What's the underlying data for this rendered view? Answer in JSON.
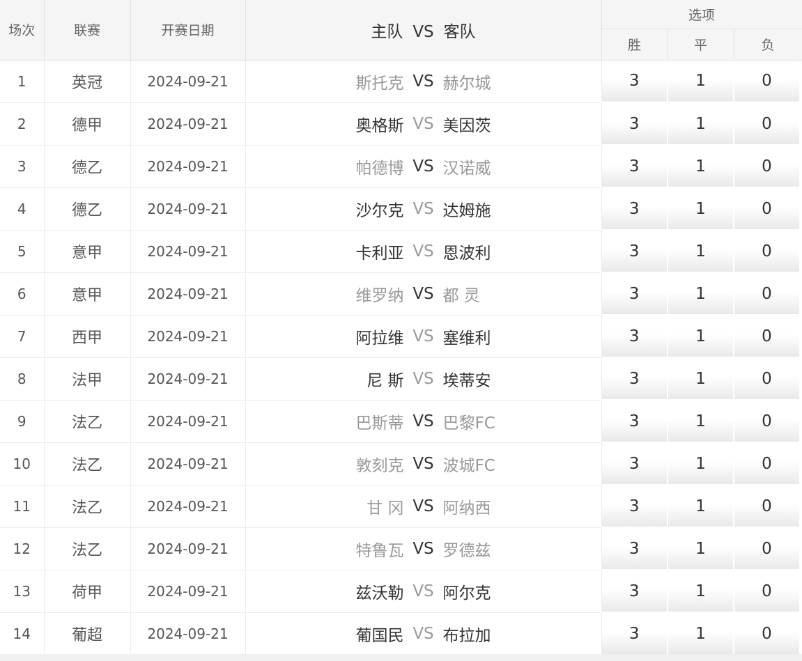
{
  "header": {
    "col_index": "场次",
    "col_league": "联赛",
    "col_date": "开赛日期",
    "col_home": "主队",
    "col_vs": "VS",
    "col_away": "客队",
    "col_options": "选项",
    "opt_win": "胜",
    "opt_draw": "平",
    "opt_lose": "负"
  },
  "colors": {
    "dark_team": "#333333",
    "light_team": "#999999",
    "header_bg": "#f5f5f5"
  },
  "rows": [
    {
      "num": "1",
      "league": "英冠",
      "date": "2024-09-21",
      "home": "斯托克",
      "vs": "VS",
      "away": "赫尔城",
      "home_style": "light",
      "vs_style": "dark",
      "away_style": "light",
      "win": "3",
      "draw": "1",
      "lose": "0"
    },
    {
      "num": "2",
      "league": "德甲",
      "date": "2024-09-21",
      "home": "奥格斯",
      "vs": "VS",
      "away": "美因茨",
      "home_style": "dark",
      "vs_style": "light",
      "away_style": "dark",
      "win": "3",
      "draw": "1",
      "lose": "0"
    },
    {
      "num": "3",
      "league": "德乙",
      "date": "2024-09-21",
      "home": "帕德博",
      "vs": "VS",
      "away": "汉诺威",
      "home_style": "light",
      "vs_style": "dark",
      "away_style": "light",
      "win": "3",
      "draw": "1",
      "lose": "0"
    },
    {
      "num": "4",
      "league": "德乙",
      "date": "2024-09-21",
      "home": "沙尔克",
      "vs": "VS",
      "away": "达姆施",
      "home_style": "dark",
      "vs_style": "light",
      "away_style": "dark",
      "win": "3",
      "draw": "1",
      "lose": "0"
    },
    {
      "num": "5",
      "league": "意甲",
      "date": "2024-09-21",
      "home": "卡利亚",
      "vs": "VS",
      "away": "恩波利",
      "home_style": "dark",
      "vs_style": "light",
      "away_style": "dark",
      "win": "3",
      "draw": "1",
      "lose": "0"
    },
    {
      "num": "6",
      "league": "意甲",
      "date": "2024-09-21",
      "home": "维罗纳",
      "vs": "VS",
      "away": "都 灵",
      "home_style": "light",
      "vs_style": "dark",
      "away_style": "light",
      "win": "3",
      "draw": "1",
      "lose": "0"
    },
    {
      "num": "7",
      "league": "西甲",
      "date": "2024-09-21",
      "home": "阿拉维",
      "vs": "VS",
      "away": "塞维利",
      "home_style": "dark",
      "vs_style": "light",
      "away_style": "dark",
      "win": "3",
      "draw": "1",
      "lose": "0"
    },
    {
      "num": "8",
      "league": "法甲",
      "date": "2024-09-21",
      "home": "尼 斯",
      "vs": "VS",
      "away": "埃蒂安",
      "home_style": "dark",
      "vs_style": "light",
      "away_style": "dark",
      "win": "3",
      "draw": "1",
      "lose": "0"
    },
    {
      "num": "9",
      "league": "法乙",
      "date": "2024-09-21",
      "home": "巴斯蒂",
      "vs": "VS",
      "away": "巴黎FC",
      "home_style": "light",
      "vs_style": "dark",
      "away_style": "light",
      "win": "3",
      "draw": "1",
      "lose": "0"
    },
    {
      "num": "10",
      "league": "法乙",
      "date": "2024-09-21",
      "home": "敦刻克",
      "vs": "VS",
      "away": "波城FC",
      "home_style": "light",
      "vs_style": "dark",
      "away_style": "light",
      "win": "3",
      "draw": "1",
      "lose": "0"
    },
    {
      "num": "11",
      "league": "法乙",
      "date": "2024-09-21",
      "home": "甘 冈",
      "vs": "VS",
      "away": "阿纳西",
      "home_style": "light",
      "vs_style": "dark",
      "away_style": "light",
      "win": "3",
      "draw": "1",
      "lose": "0"
    },
    {
      "num": "12",
      "league": "法乙",
      "date": "2024-09-21",
      "home": "特鲁瓦",
      "vs": "VS",
      "away": "罗德兹",
      "home_style": "light",
      "vs_style": "dark",
      "away_style": "light",
      "win": "3",
      "draw": "1",
      "lose": "0"
    },
    {
      "num": "13",
      "league": "荷甲",
      "date": "2024-09-21",
      "home": "兹沃勒",
      "vs": "VS",
      "away": "阿尔克",
      "home_style": "dark",
      "vs_style": "light",
      "away_style": "dark",
      "win": "3",
      "draw": "1",
      "lose": "0"
    },
    {
      "num": "14",
      "league": "葡超",
      "date": "2024-09-21",
      "home": "葡国民",
      "vs": "VS",
      "away": "布拉加",
      "home_style": "dark",
      "vs_style": "light",
      "away_style": "dark",
      "win": "3",
      "draw": "1",
      "lose": "0"
    }
  ]
}
